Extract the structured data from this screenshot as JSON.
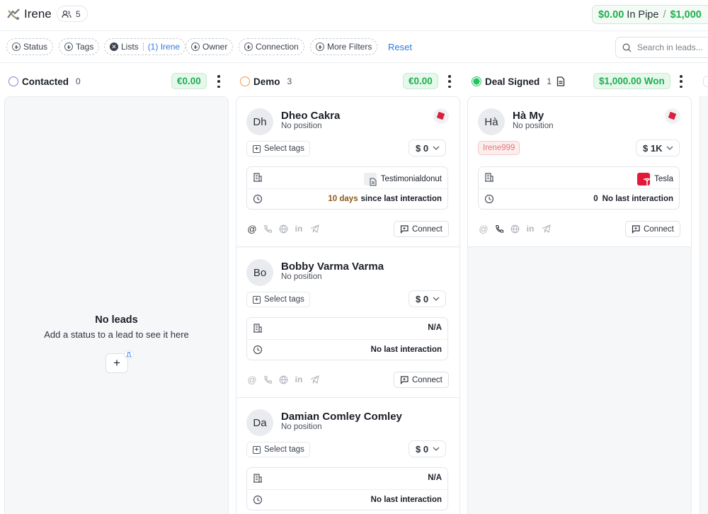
{
  "header": {
    "title": "Irene",
    "member_count": "5",
    "pipe_value": "$0.00",
    "pipe_label": "In Pipe",
    "pipe_separator": "/",
    "won_value": "$1,000"
  },
  "filters": {
    "status": "Status",
    "tags": "Tags",
    "lists": "Lists",
    "lists_value": "(1) Irene",
    "owner": "Owner",
    "connection": "Connection",
    "more": "More Filters",
    "reset": "Reset",
    "search_placeholder": "Search in leads..."
  },
  "columns": [
    {
      "title": "Contacted",
      "count": "0",
      "amount": "€0.00",
      "status_color": "#8a7fd6",
      "empty_title": "No leads",
      "empty_subtitle": "Add a status to a lead to see it here",
      "add_label": "+"
    },
    {
      "title": "Demo",
      "count": "3",
      "amount": "€0.00",
      "status_color": "#f2994a",
      "cards": [
        {
          "initials": "Dh",
          "name": "Dheo Cakra",
          "position": "No position",
          "tags_label": "Select tags",
          "value": "$ 0",
          "company": "Testimonialdonut",
          "company_icon": "document-icon",
          "interaction_days": "10 days",
          "interaction_text": "since last interaction",
          "connect": "Connect"
        },
        {
          "initials": "Bo",
          "name": "Bobby Varma Varma",
          "position": "No position",
          "tags_label": "Select tags",
          "value": "$ 0",
          "company": "N/A",
          "interaction_text": "No last interaction",
          "connect": "Connect"
        },
        {
          "initials": "Da",
          "name": "Damian Comley Comley",
          "position": "No position",
          "tags_label": "Select tags",
          "value": "$ 0",
          "company": "N/A",
          "interaction_text": "No last interaction"
        }
      ]
    },
    {
      "title": "Deal Signed",
      "count": "1",
      "amount": "$1,000.00 Won",
      "status_color": "#22c55e",
      "cards": [
        {
          "initials": "Hà",
          "name": "Hà My",
          "position": "No position",
          "owner_tag": "Irene999",
          "value": "$ 1K",
          "company": "Tesla",
          "company_icon": "tesla-logo-icon",
          "company_color": "#e31937",
          "interaction_days": "0",
          "interaction_text": "No last interaction",
          "connect": "Connect"
        }
      ]
    }
  ]
}
